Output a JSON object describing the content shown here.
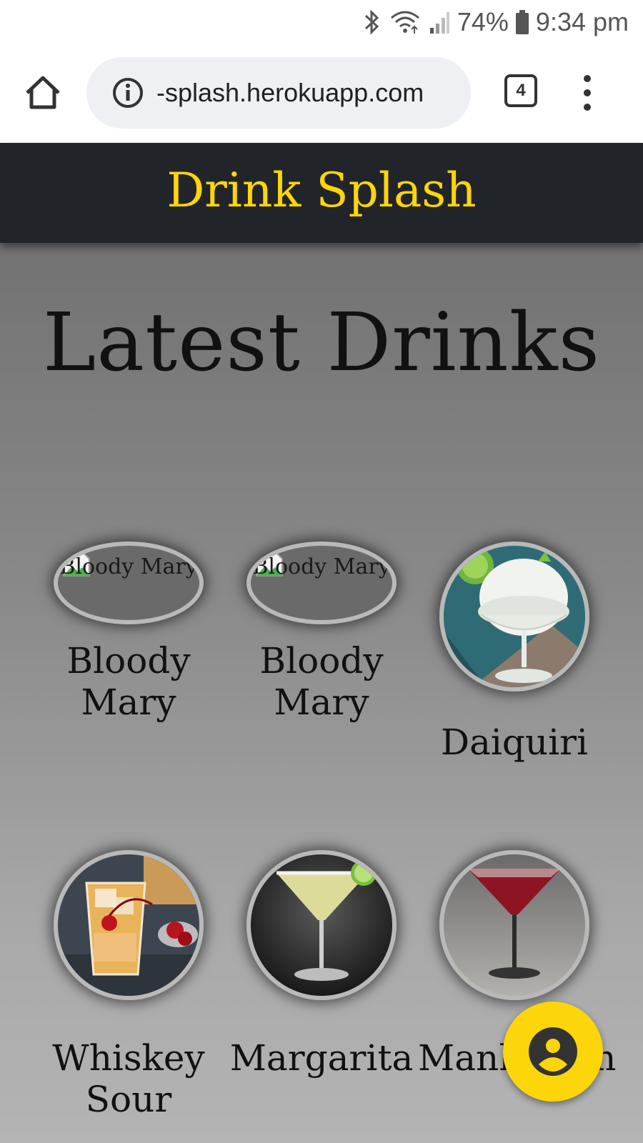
{
  "status_bar": {
    "battery": "74%",
    "time": "9:34 pm",
    "icons": [
      "bluetooth-icon",
      "wifi-icon",
      "signal-icon",
      "battery-icon"
    ]
  },
  "browser": {
    "url": "-splash.herokuapp.com",
    "tab_count": "4",
    "icons": [
      "home-icon",
      "info-icon",
      "tabs-icon",
      "more-vert-icon"
    ]
  },
  "header": {
    "brand": "Drink Splash",
    "brand_color": "#fdd50b",
    "background": "#212529"
  },
  "main": {
    "title": "Latest Drinks",
    "drinks": [
      {
        "name": "Bloody Mary",
        "image": "broken",
        "alt": "Bloody Mary"
      },
      {
        "name": "Bloody Mary",
        "image": "broken",
        "alt": "Bloody Mary"
      },
      {
        "name": "Daiquiri",
        "image": "frozen-daiquiri-photo"
      },
      {
        "name": "Whiskey Sour",
        "image": "whiskey-sour-photo"
      },
      {
        "name": "Margarita",
        "image": "margarita-photo"
      },
      {
        "name": "Manhattan",
        "image": "manhattan-photo"
      }
    ]
  },
  "fab": {
    "icon": "account-circle-icon"
  }
}
